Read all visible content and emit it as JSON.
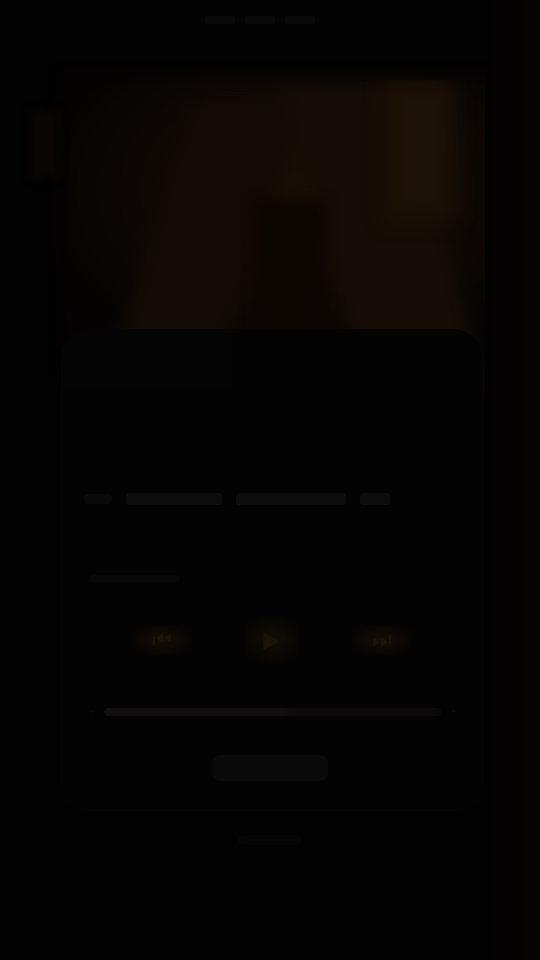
{
  "status_bar": {
    "time": ""
  },
  "player": {
    "title": "",
    "artist": "",
    "duration": "",
    "progress_fraction": 0.55,
    "controls": [
      {
        "name": "previous",
        "icon": "skip-previous-icon"
      },
      {
        "name": "play",
        "icon": "play-icon"
      },
      {
        "name": "next",
        "icon": "skip-next-icon"
      }
    ],
    "bottom_button_label": ""
  },
  "colors": {
    "background": "#030202",
    "accent": "#1b1306"
  }
}
